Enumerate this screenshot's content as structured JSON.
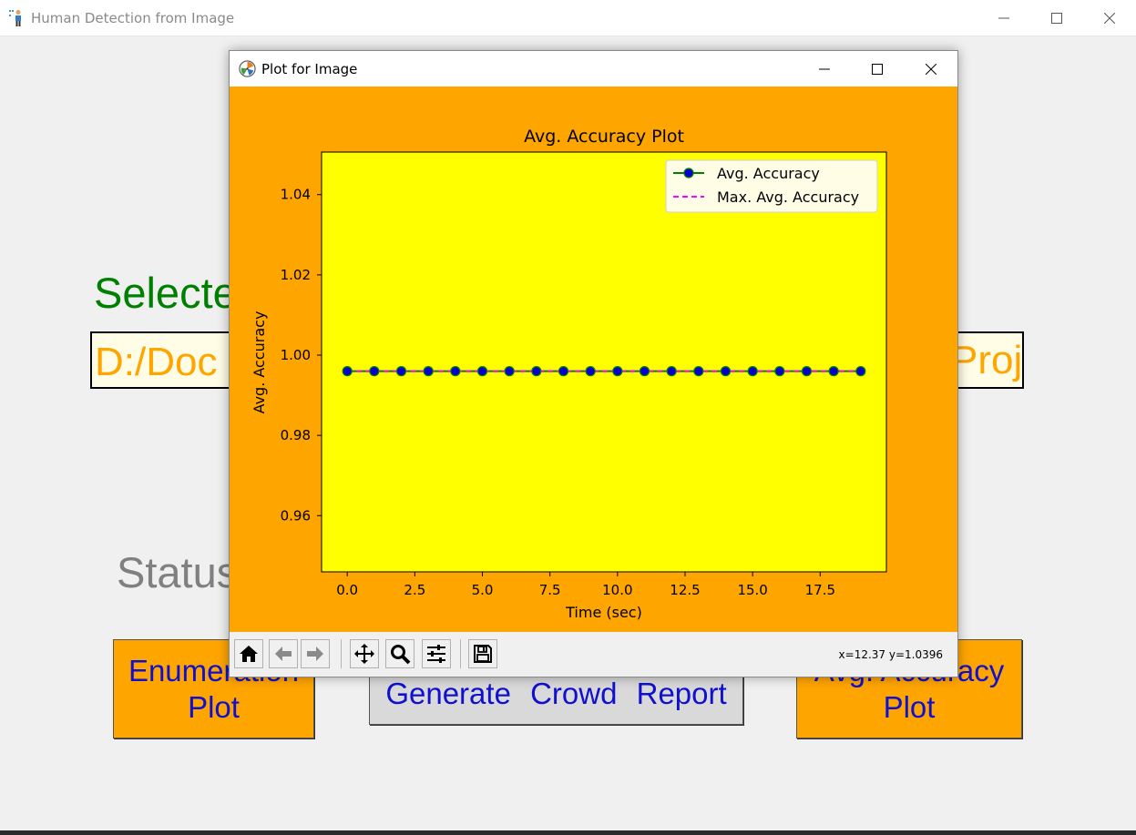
{
  "main_window": {
    "title": "Human Detection from Image",
    "selected_label": "Selecte",
    "path_text": "D:/Doc",
    "path_tail": "Proj",
    "status_label": "Status",
    "buttons": {
      "enumeration_line1": "Enumeration",
      "enumeration_line2": "Plot",
      "crowd_report": "Generate  Crowd  Report",
      "accuracy_line1": "Avg. Accuracy",
      "accuracy_line2": "Plot"
    }
  },
  "plot_window": {
    "title": "Plot for Image",
    "coords": "x=12.37 y=1.0396",
    "toolbar": [
      "home-icon",
      "back-arrow-icon",
      "forward-arrow-icon",
      "pan-icon",
      "zoom-icon",
      "configure-subplots-icon",
      "save-icon"
    ]
  },
  "colors": {
    "figure_bg": "#ffa500",
    "axes_bg": "#ffff00",
    "series_line": "#008000",
    "series_marker": "#0000cd",
    "max_line": "#ff00ff"
  },
  "chart_data": {
    "type": "line",
    "title": "Avg. Accuracy Plot",
    "xlabel": "Time (sec)",
    "ylabel": "Avg. Accuracy",
    "xlim": [
      -0.95,
      19.95
    ],
    "ylim": [
      0.946,
      1.0506
    ],
    "xticks": [
      0.0,
      2.5,
      5.0,
      7.5,
      10.0,
      12.5,
      15.0,
      17.5
    ],
    "xtick_labels": [
      "0.0",
      "2.5",
      "5.0",
      "7.5",
      "10.0",
      "12.5",
      "15.0",
      "17.5"
    ],
    "yticks": [
      0.96,
      0.98,
      1.0,
      1.02,
      1.04
    ],
    "ytick_labels": [
      "0.96",
      "0.98",
      "1.00",
      "1.02",
      "1.04"
    ],
    "legend_position": "upper right",
    "grid": false,
    "series": [
      {
        "name": "Avg. Accuracy",
        "style": "solid-with-markers",
        "x": [
          0,
          1,
          2,
          3,
          4,
          5,
          6,
          7,
          8,
          9,
          10,
          11,
          12,
          13,
          14,
          15,
          16,
          17,
          18,
          19
        ],
        "y": [
          0.996,
          0.996,
          0.996,
          0.996,
          0.996,
          0.996,
          0.996,
          0.996,
          0.996,
          0.996,
          0.996,
          0.996,
          0.996,
          0.996,
          0.996,
          0.996,
          0.996,
          0.996,
          0.996,
          0.996
        ]
      },
      {
        "name": "Max. Avg. Accuracy",
        "style": "dashed",
        "x": [
          0,
          19
        ],
        "y": [
          0.996,
          0.996
        ]
      }
    ]
  }
}
